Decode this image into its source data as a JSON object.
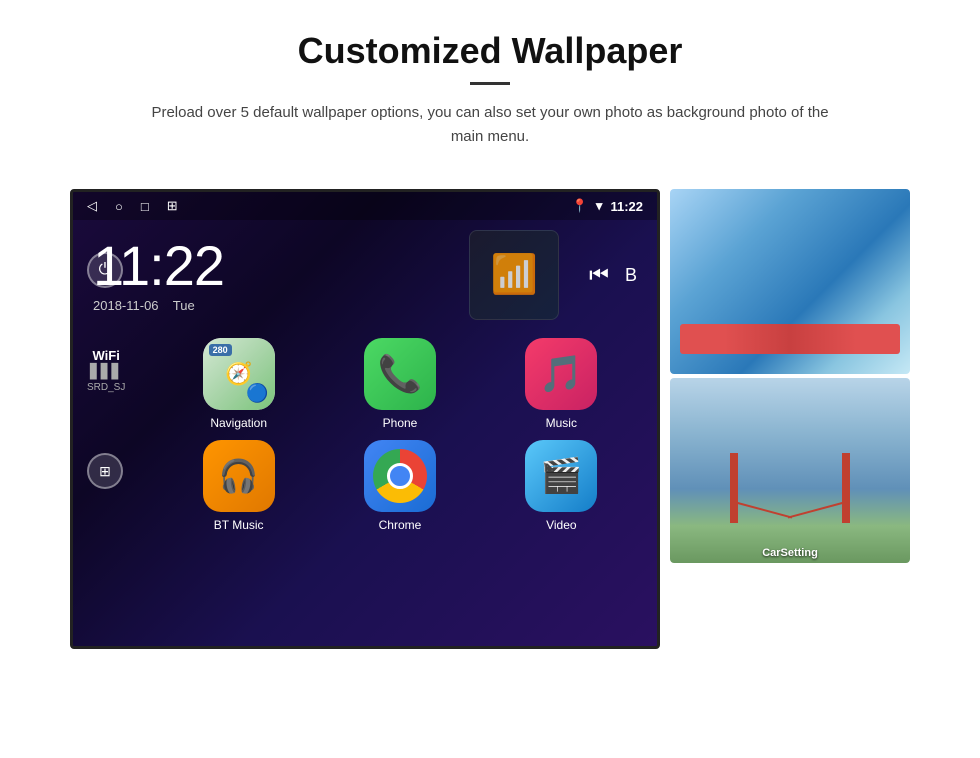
{
  "header": {
    "title": "Customized Wallpaper",
    "description": "Preload over 5 default wallpaper options, you can also set your own photo as background photo of the main menu."
  },
  "android": {
    "status_bar": {
      "time": "11:22",
      "nav_back": "◁",
      "nav_home": "○",
      "nav_recent": "□",
      "nav_screenshot": "⊞",
      "location_icon": "📍",
      "wifi_icon": "▾",
      "time_label": "11:22"
    },
    "clock": {
      "time": "11:22",
      "date": "2018-11-06",
      "day": "Tue"
    },
    "wifi": {
      "label": "WiFi",
      "bars": "▋▋▋",
      "ssid": "SRD_SJ"
    },
    "apps": [
      {
        "id": "navigation",
        "label": "Navigation",
        "badge": "280"
      },
      {
        "id": "phone",
        "label": "Phone"
      },
      {
        "id": "music",
        "label": "Music"
      },
      {
        "id": "bt_music",
        "label": "BT Music"
      },
      {
        "id": "chrome",
        "label": "Chrome"
      },
      {
        "id": "video",
        "label": "Video"
      }
    ],
    "wallpapers": [
      {
        "id": "ice",
        "label": ""
      },
      {
        "id": "bridge",
        "label": "CarSetting"
      }
    ]
  }
}
